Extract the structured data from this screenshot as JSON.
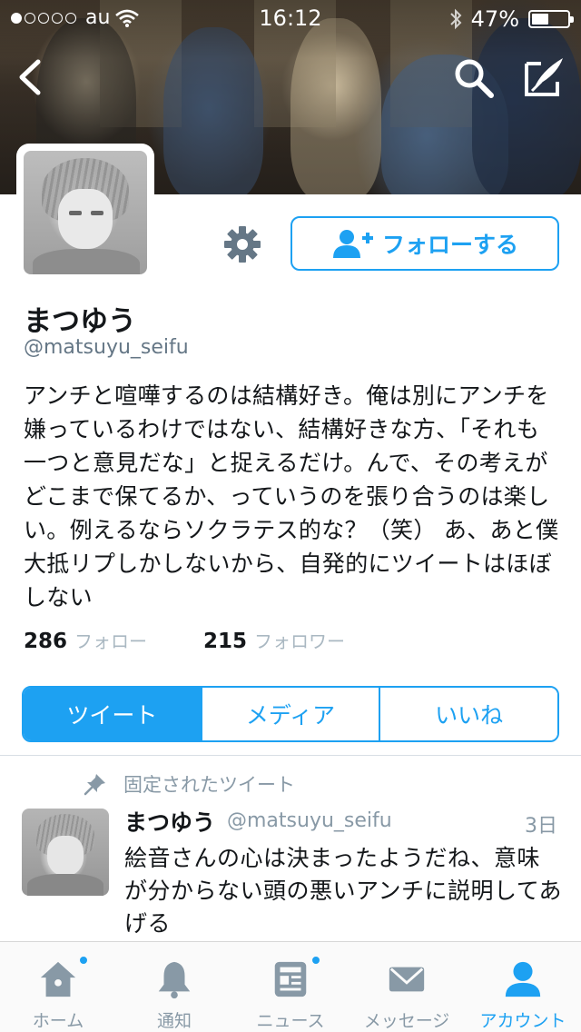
{
  "status_bar": {
    "carrier": "au",
    "time": "16:12",
    "battery_text": "47%",
    "battery_level": 0.47,
    "signal_bars_filled": 1,
    "signal_bars_total": 5
  },
  "profile": {
    "display_name": "まつゆう",
    "handle": "@matsuyu_seifu",
    "bio": "アンチと喧嘩するのは結構好き。俺は別にアンチを嫌っているわけではない、結構好きな方、「それも一つと意見だな」と捉えるだけ。んで、その考えがどこまで保てるか、っていうのを張り合うのは楽しい。例えるならソクラテス的な？（笑） あ、あと僕大抵リプしかしないから、自発的にツイートはほぼしない",
    "follow_button_label": "フォローする",
    "following_count": "286",
    "following_label": "フォロー",
    "followers_count": "215",
    "followers_label": "フォロワー"
  },
  "profile_tabs": [
    {
      "label": "ツイート",
      "active": true
    },
    {
      "label": "メディア",
      "active": false
    },
    {
      "label": "いいね",
      "active": false
    }
  ],
  "pinned_tweet": {
    "pinned_label": "固定されたツイート",
    "author_name": "まつゆう",
    "author_handle": "@matsuyu_seifu",
    "time": "3日",
    "text": "絵音さんの心は決まったようだね、意味が分からない頭の悪いアンチに説明してあげる"
  },
  "bottom_tabs": [
    {
      "label": "ホーム",
      "icon": "home-icon",
      "active": false,
      "badge": true
    },
    {
      "label": "通知",
      "icon": "bell-icon",
      "active": false,
      "badge": false
    },
    {
      "label": "ニュース",
      "icon": "news-icon",
      "active": false,
      "badge": true
    },
    {
      "label": "メッセージ",
      "icon": "envelope-icon",
      "active": false,
      "badge": false
    },
    {
      "label": "アカウント",
      "icon": "person-icon",
      "active": true,
      "badge": false
    }
  ],
  "colors": {
    "accent": "#1da1f2",
    "inactive_icon": "#8899a6",
    "secondary_text": "#657786"
  }
}
